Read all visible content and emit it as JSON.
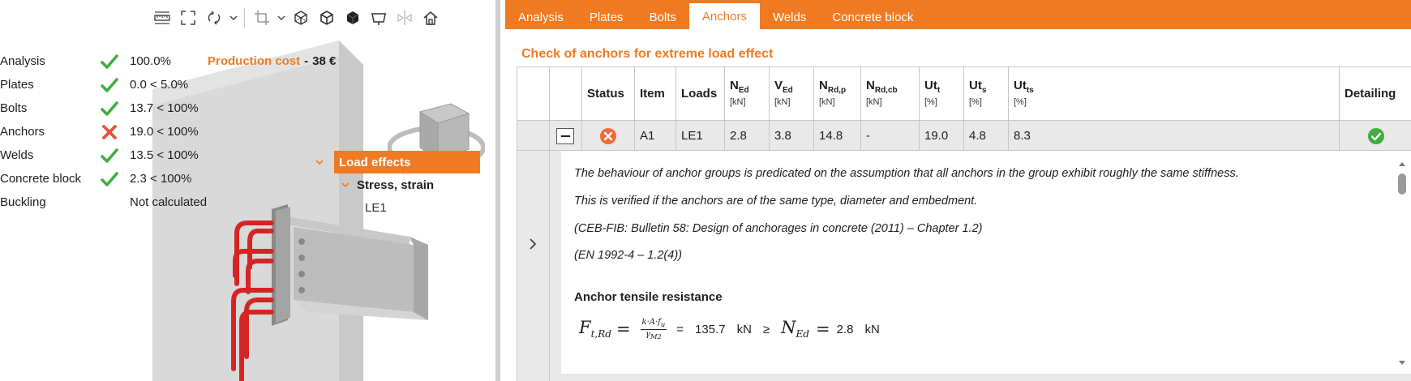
{
  "toolbar": {
    "icons": [
      "ruler-icon",
      "fit-view-icon",
      "rotate-icon",
      "crop-icon",
      "wireframe-cube-icon",
      "transparent-cube-icon",
      "solid-cube-icon",
      "section-view-icon",
      "mirror-icon",
      "home-icon"
    ]
  },
  "summary": {
    "rows": [
      {
        "label": "Analysis",
        "status": "ok",
        "value": "100.0%"
      },
      {
        "label": "Plates",
        "status": "ok",
        "value": "0.0 < 5.0%"
      },
      {
        "label": "Bolts",
        "status": "ok",
        "value": "13.7 < 100%"
      },
      {
        "label": "Anchors",
        "status": "fail",
        "value": "19.0 < 100%"
      },
      {
        "label": "Welds",
        "status": "ok",
        "value": "13.5 < 100%"
      },
      {
        "label": "Concrete block",
        "status": "ok",
        "value": "2.3 < 100%"
      },
      {
        "label": "Buckling",
        "status": "none",
        "value": "Not calculated"
      }
    ],
    "production_cost_label": "Production cost",
    "production_cost_sep": "-",
    "production_cost_value": "38 €"
  },
  "tree": {
    "load_effects": "Load effects",
    "stress_strain": "Stress, strain",
    "le1": "LE1"
  },
  "tabs": [
    {
      "label": "Analysis",
      "active": false
    },
    {
      "label": "Plates",
      "active": false
    },
    {
      "label": "Bolts",
      "active": false
    },
    {
      "label": "Anchors",
      "active": true
    },
    {
      "label": "Welds",
      "active": false
    },
    {
      "label": "Concrete block",
      "active": false
    }
  ],
  "section_title": "Check of anchors for extreme load effect",
  "table": {
    "headers": {
      "status": "Status",
      "item": "Item",
      "loads": "Loads",
      "ned": {
        "main": "N",
        "sub": "Ed",
        "unit": "[kN]"
      },
      "ved": {
        "main": "V",
        "sub": "Ed",
        "unit": "[kN]"
      },
      "nrdp": {
        "main": "N",
        "sub": "Rd,p",
        "unit": "[kN]"
      },
      "nrdcb": {
        "main": "N",
        "sub": "Rd,cb",
        "unit": "[kN]"
      },
      "utt": {
        "main": "Ut",
        "sub": "t",
        "unit": "[%]"
      },
      "uts": {
        "main": "Ut",
        "sub": "s",
        "unit": "[%]"
      },
      "utts": {
        "main": "Ut",
        "sub": "ts",
        "unit": "[%]"
      },
      "detailing": "Detailing"
    },
    "row": {
      "status": "fail",
      "item": "A1",
      "loads": "LE1",
      "ned": "2.8",
      "ved": "3.8",
      "nrdp": "14.8",
      "nrdcb": "-",
      "utt": "19.0",
      "uts": "4.8",
      "utts": "8.3",
      "detailing": "ok"
    }
  },
  "detail": {
    "line1": "The behaviour of anchor groups is predicated on the assumption that all anchors in the group exhibit roughly the same stiffness.",
    "line2": "This is verified if the anchors are of the same type, diameter and embedment.",
    "line3": "(CEB-FIB: Bulletin 58: Design of anchorages in concrete (2011) – Chapter 1.2)",
    "line4": "(EN 1992-4 – 1.2(4))",
    "subheading": "Anchor tensile resistance",
    "formula": {
      "lhs_main": "F",
      "lhs_sub": "t,Rd",
      "equals": "=",
      "num": "k·A·f",
      "num_sub": "u",
      "den": "γ",
      "den_sub": "M2",
      "equals2": "=",
      "value": "135.7",
      "unit": "kN",
      "geq": "≥",
      "rhs_main": "N",
      "rhs_sub": "Ed",
      "equals3": "=",
      "rhs_value": "2.8",
      "rhs_unit": "kN"
    }
  },
  "colors": {
    "accent": "#f07a22",
    "ok": "#3fae3f",
    "fail": "#e8533f",
    "anchor_red": "#d42525"
  }
}
